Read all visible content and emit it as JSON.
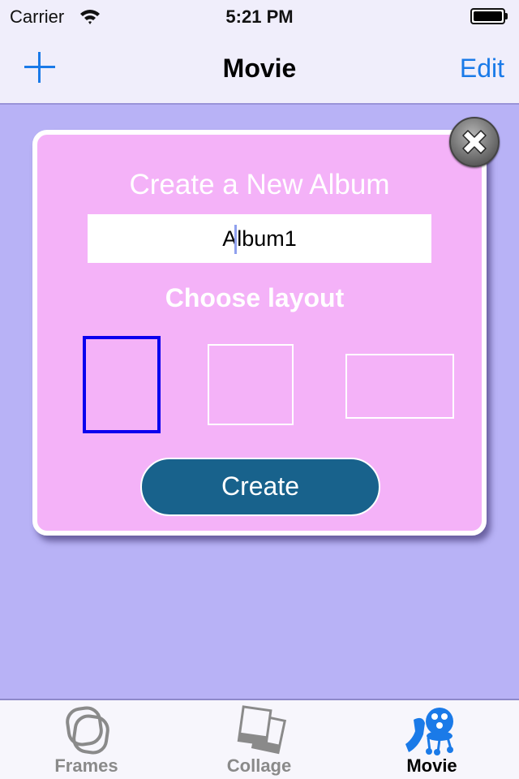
{
  "status_bar": {
    "carrier": "Carrier",
    "time": "5:21 PM",
    "wifi_icon": "wifi-icon",
    "battery_icon": "battery-full-icon",
    "battery_level_percent": 100
  },
  "nav_bar": {
    "add_icon": "plus-icon",
    "title": "Movie",
    "edit_label": "Edit",
    "accent_color": "#1a7ae8"
  },
  "dialog": {
    "title": "Create a New Album",
    "album_name_value": "Album1",
    "choose_layout_label": "Choose layout",
    "layouts": [
      {
        "id": "portrait",
        "selected": true
      },
      {
        "id": "square",
        "selected": false
      },
      {
        "id": "landscape",
        "selected": false
      }
    ],
    "selected_color": "#0a00ee",
    "create_label": "Create",
    "close_icon": "close-icon",
    "background_color": "#f4b2f8",
    "button_color": "#18628c"
  },
  "tab_bar": {
    "items": [
      {
        "label": "Frames",
        "icon": "frames-icon",
        "active": false
      },
      {
        "label": "Collage",
        "icon": "collage-icon",
        "active": false
      },
      {
        "label": "Movie",
        "icon": "movie-reel-icon",
        "active": true
      }
    ]
  },
  "colors": {
    "page_background": "#b8b2f6",
    "bar_background": "#f0eefb"
  }
}
